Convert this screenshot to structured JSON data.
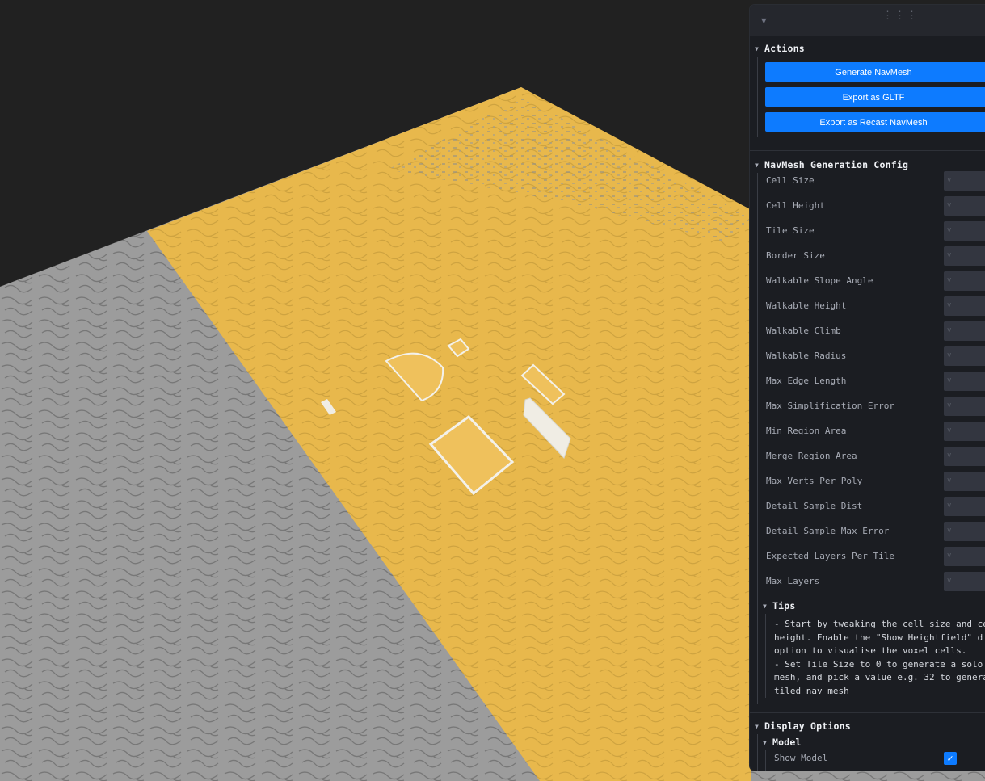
{
  "scene": {
    "colors": {
      "background": "#212121",
      "navmesh": "#e8b84c",
      "ground": "#9c9c9c",
      "obstacle": "#f2f2ee"
    }
  },
  "panel": {
    "collapse_icon": "chevron-down-icon",
    "drag_icon": "drag-handle-icon",
    "actions": {
      "title": "Actions",
      "buttons": [
        "Generate NavMesh",
        "Export as GLTF",
        "Export as Recast NavMesh"
      ]
    },
    "config": {
      "title": "NavMesh Generation Config",
      "fields": [
        {
          "label": "Cell Size",
          "placeholder": "v"
        },
        {
          "label": "Cell Height",
          "placeholder": "v"
        },
        {
          "label": "Tile Size",
          "placeholder": "v"
        },
        {
          "label": "Border Size",
          "placeholder": "v"
        },
        {
          "label": "Walkable Slope Angle",
          "placeholder": "v"
        },
        {
          "label": "Walkable Height",
          "placeholder": "v"
        },
        {
          "label": "Walkable Climb",
          "placeholder": "v"
        },
        {
          "label": "Walkable Radius",
          "placeholder": "v"
        },
        {
          "label": "Max Edge Length",
          "placeholder": "v"
        },
        {
          "label": "Max Simplification Error",
          "placeholder": "v"
        },
        {
          "label": "Min Region Area",
          "placeholder": "v"
        },
        {
          "label": "Merge Region Area",
          "placeholder": "v"
        },
        {
          "label": "Max Verts Per Poly",
          "placeholder": "v"
        },
        {
          "label": "Detail Sample Dist",
          "placeholder": "v"
        },
        {
          "label": "Detail Sample Max Error",
          "placeholder": "v"
        },
        {
          "label": "Expected Layers Per Tile",
          "placeholder": "v"
        },
        {
          "label": "Max Layers",
          "placeholder": "v"
        }
      ],
      "tips": {
        "title": "Tips",
        "text": "- Start by tweaking the cell size and ce\nheight. Enable the \"Show Heightfield\" di\noption to visualise the voxel cells.\n- Set Tile Size to 0 to generate a solo\nmesh, and pick a value e.g. 32 to genera\ntiled nav mesh"
      }
    },
    "display": {
      "title": "Display Options",
      "model": {
        "title": "Model",
        "show_model_label": "Show Model",
        "show_model_checked": true
      }
    }
  }
}
